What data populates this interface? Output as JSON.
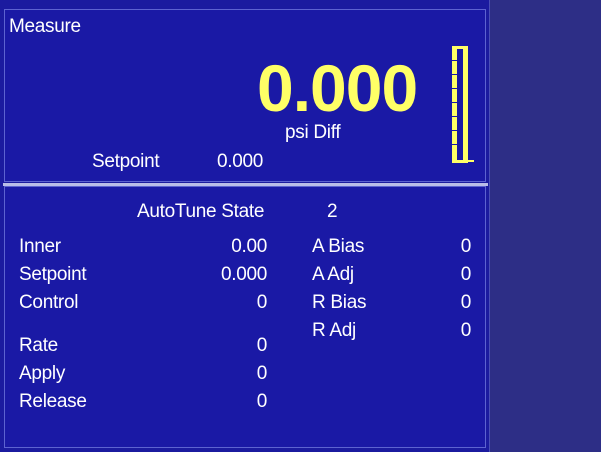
{
  "measure": {
    "title": "Measure",
    "value": "0.000",
    "units": "psi Diff",
    "setpoint_label": "Setpoint",
    "setpoint_value": "0.000",
    "bargraph_level": 0
  },
  "autotune": {
    "label": "AutoTune State",
    "value": "2"
  },
  "left_params": [
    {
      "label": "Inner",
      "value": "0.00"
    },
    {
      "label": "Setpoint",
      "value": "0.000"
    },
    {
      "label": "Control",
      "value": "0"
    },
    {
      "label": "Rate",
      "value": "0"
    },
    {
      "label": "Apply",
      "value": "0"
    },
    {
      "label": "Release",
      "value": "0"
    }
  ],
  "right_params": [
    {
      "label": "A Bias",
      "value": "0"
    },
    {
      "label": "A Adj",
      "value": "0"
    },
    {
      "label": "R Bias",
      "value": "0"
    },
    {
      "label": "R Adj",
      "value": "0"
    }
  ],
  "colors": {
    "background": "#1a19a5",
    "side_panel": "#2d2e86",
    "accent_yellow": "#ffff66",
    "text": "#ffffff"
  }
}
